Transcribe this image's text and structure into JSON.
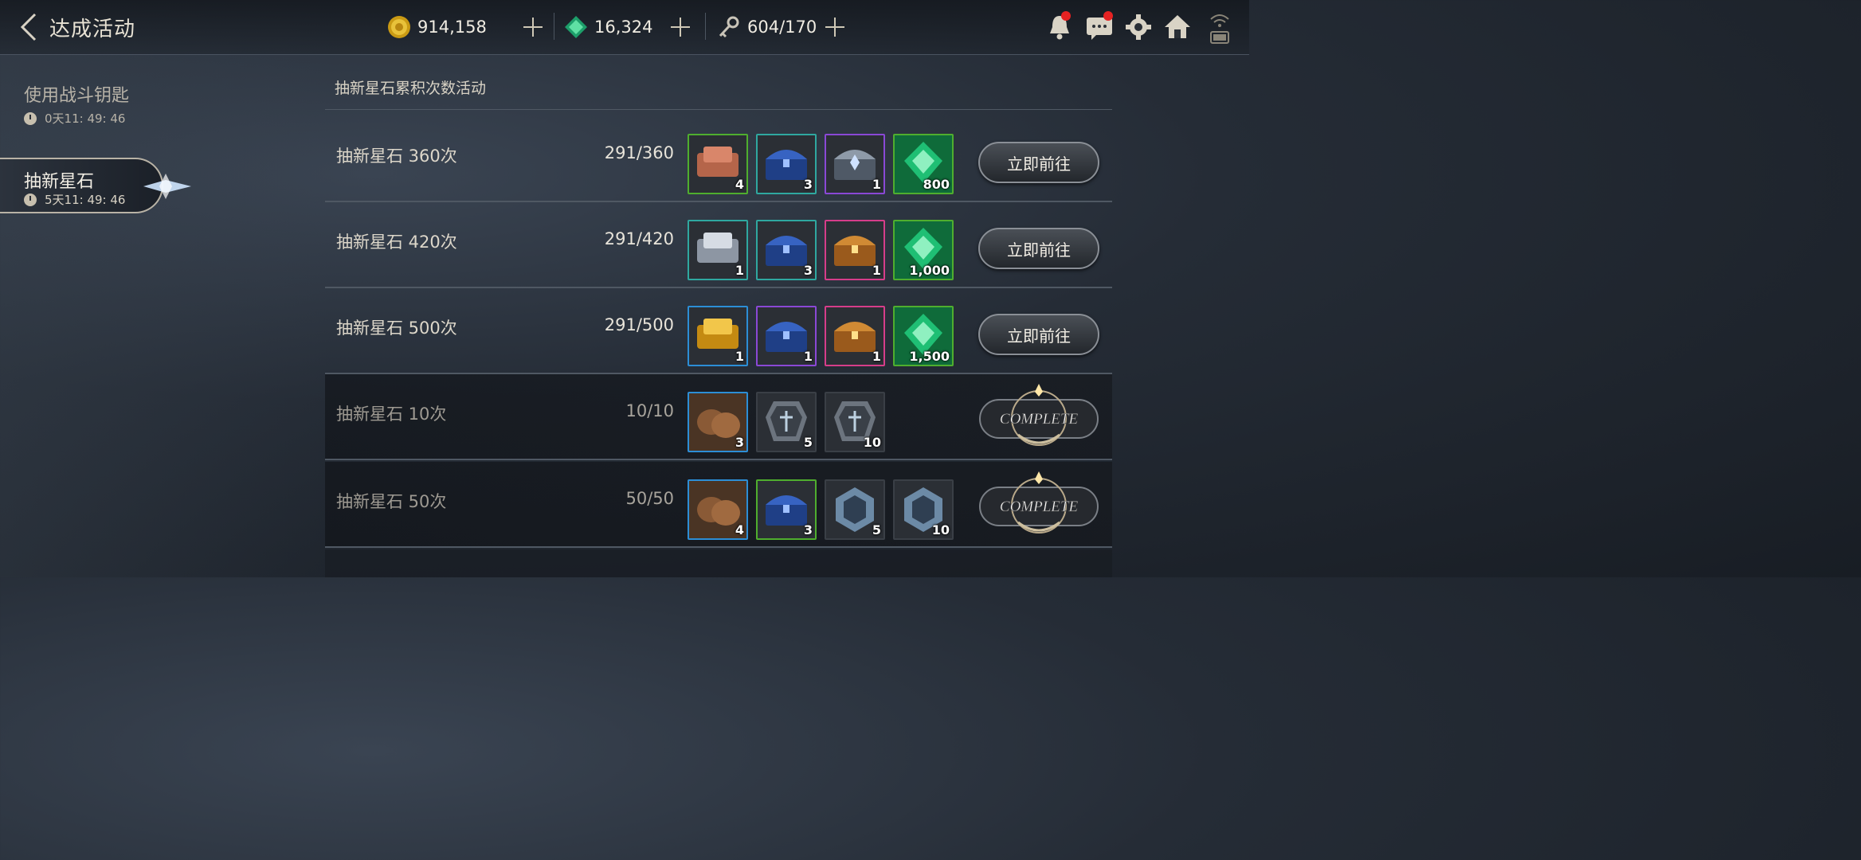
{
  "header": {
    "title": "达成活动",
    "gold": "914,158",
    "gems": "16,324",
    "keys": "604/170"
  },
  "sidebar": {
    "items": [
      {
        "label": "使用战斗钥匙",
        "time": "0天11: 49: 46"
      },
      {
        "label": "抽新星石",
        "time": "5天11: 49: 46"
      }
    ]
  },
  "panel": {
    "title": "抽新星石累积次数活动",
    "go_label": "立即前往",
    "rows": [
      {
        "label": "抽新星石  360次",
        "progress": "291/360",
        "state": "go",
        "rewards": [
          {
            "icon": "copper-ingot-icon",
            "count": "4",
            "frame": "#4fae2e"
          },
          {
            "icon": "blue-chest-icon",
            "count": "3",
            "frame": "#2fa8a0"
          },
          {
            "icon": "silver-chest-icon",
            "count": "1",
            "frame": "#8a48d6"
          },
          {
            "icon": "green-gem-icon",
            "count": "800",
            "frame": "#4fae2e"
          }
        ]
      },
      {
        "label": "抽新星石  420次",
        "progress": "291/420",
        "state": "go",
        "rewards": [
          {
            "icon": "silver-ingot-icon",
            "count": "1",
            "frame": "#2fa8a0"
          },
          {
            "icon": "blue-chest-icon",
            "count": "3",
            "frame": "#2fa8a0"
          },
          {
            "icon": "gold-chest-icon",
            "count": "1",
            "frame": "#d63d8a"
          },
          {
            "icon": "green-gem-icon",
            "count": "1,000",
            "frame": "#4fae2e"
          }
        ]
      },
      {
        "label": "抽新星石  500次",
        "progress": "291/500",
        "state": "go",
        "rewards": [
          {
            "icon": "gold-ingot-icon",
            "count": "1",
            "frame": "#2c8ed6"
          },
          {
            "icon": "blue-chest-icon",
            "count": "1",
            "frame": "#8a48d6"
          },
          {
            "icon": "gold-chest-icon",
            "count": "1",
            "frame": "#d63d8a"
          },
          {
            "icon": "green-gem-icon",
            "count": "1,500",
            "frame": "#4fae2e"
          }
        ]
      },
      {
        "label": "抽新星石  10次",
        "progress": "10/10",
        "state": "complete",
        "rewards": [
          {
            "icon": "leather-pouch-icon",
            "count": "3",
            "frame": "#2c8ed6"
          },
          {
            "icon": "rune-crystal-icon",
            "count": "5",
            "frame": "#3a3f46"
          },
          {
            "icon": "rune-crystal-icon",
            "count": "10",
            "frame": "#3a3f46"
          }
        ]
      },
      {
        "label": "抽新星石  50次",
        "progress": "50/50",
        "state": "complete",
        "rewards": [
          {
            "icon": "leather-pouch-icon",
            "count": "4",
            "frame": "#2c8ed6"
          },
          {
            "icon": "blue-chest-icon",
            "count": "3",
            "frame": "#4fae2e"
          },
          {
            "icon": "hex-crystal-icon",
            "count": "5",
            "frame": "#3a3f46"
          },
          {
            "icon": "hex-crystal-icon",
            "count": "10",
            "frame": "#3a3f46"
          }
        ]
      }
    ]
  },
  "complete_badge": "COMPLETE"
}
